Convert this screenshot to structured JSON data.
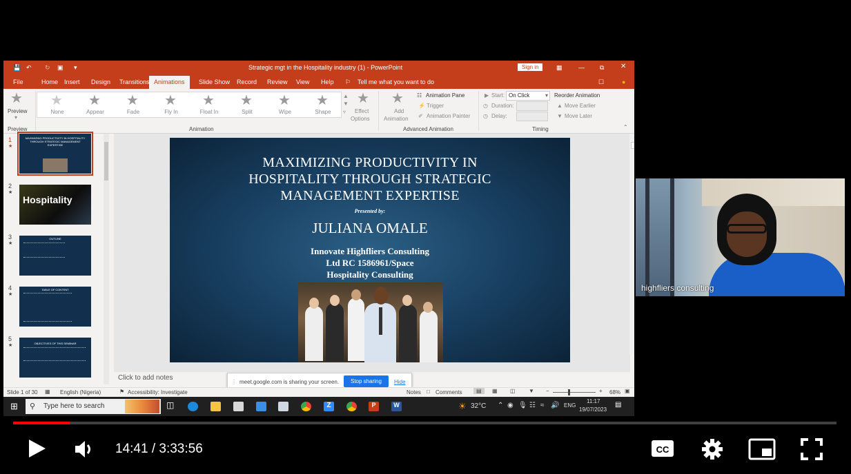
{
  "app": {
    "window_title": "Strategic mgt in the Hospitality industry (1)  -  PowerPoint",
    "sign_in": "Sign in"
  },
  "tabs": [
    "File",
    "Home",
    "Insert",
    "Design",
    "Transitions",
    "Animations",
    "Slide Show",
    "Record",
    "Review",
    "View",
    "Help"
  ],
  "active_tab": "Animations",
  "tell_me": "Tell me what you want to do",
  "ribbon": {
    "preview": "Preview",
    "animations": [
      "None",
      "Appear",
      "Fade",
      "Fly In",
      "Float In",
      "Split",
      "Wipe",
      "Shape"
    ],
    "effect_options": [
      "Effect",
      "Options"
    ],
    "add_animation": [
      "Add",
      "Animation"
    ],
    "animation_pane": "Animation Pane",
    "trigger": "Trigger",
    "animation_painter": "Animation Painter",
    "start_label": "Start:",
    "start_value": "On Click",
    "duration_label": "Duration:",
    "delay_label": "Delay:",
    "reorder_title": "Reorder Animation",
    "move_earlier": "Move Earlier",
    "move_later": "Move Later",
    "groups": {
      "preview": "Preview",
      "animation": "Animation",
      "advanced": "Advanced Animation",
      "timing": "Timing"
    }
  },
  "thumbnails": [
    {
      "num": "1",
      "text": "MAXIMIZING PRODUCTIVITY IN HOSPITALITY THROUGH STRATEGIC MANAGEMENT EXPERTISE"
    },
    {
      "num": "2",
      "text": "Hospitality"
    },
    {
      "num": "3",
      "text": "OUTLINE"
    },
    {
      "num": "4",
      "text": "TABLE OF CONTENT"
    },
    {
      "num": "5",
      "text": "OBJECTIVES OF THIS SEMINAR"
    }
  ],
  "slide": {
    "title": "MAXIMIZING PRODUCTIVITY IN HOSPITALITY THROUGH STRATEGIC MANAGEMENT EXPERTISE",
    "presented_by": "Presented by:",
    "presenter": "JULIANA OMALE",
    "company_line1": "Innovate Highfliers Consulting",
    "company_line2_a": "Ltd RC ",
    "company_line2_b": "1586961/Space",
    "company_line3": "Hospitality Consulting"
  },
  "notes_placeholder": "Click to add notes",
  "share": {
    "message": "meet.google.com is sharing your screen.",
    "stop": "Stop sharing",
    "hide": "Hide"
  },
  "status": {
    "slide": "Slide 1 of 30",
    "language": "English (Nigeria)",
    "accessibility": "Accessibility: Investigate",
    "notes": "Notes",
    "comments": "Comments",
    "zoom": "68%"
  },
  "taskbar": {
    "search": "Type here to search",
    "temp": "32°C",
    "lang": "ENG",
    "time": "11:17",
    "date": "19/07/2023"
  },
  "webcam": {
    "name": "highfliers consulting"
  },
  "player": {
    "current": "14:41",
    "separator": " / ",
    "duration": "3:33:56",
    "progress": 0.069,
    "accent": "#ff0000"
  }
}
